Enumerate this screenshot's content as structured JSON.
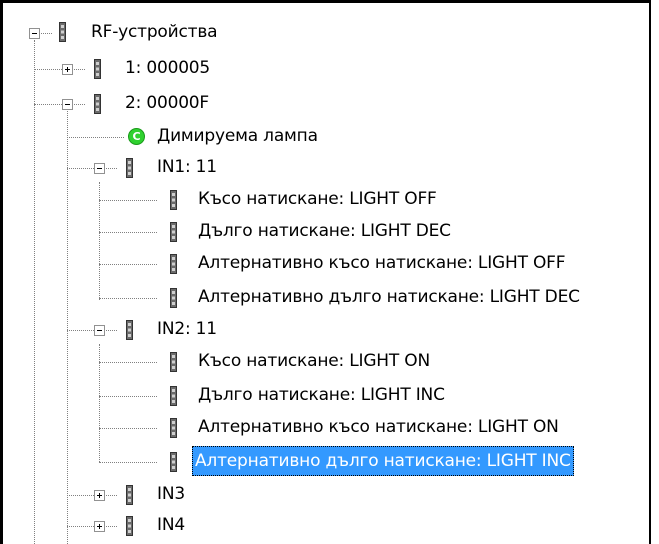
{
  "tree": {
    "root": {
      "label": "RF-устройства",
      "expanded": true
    },
    "dev1": {
      "label": "1: 000005",
      "expanded": false
    },
    "dev2": {
      "label": "2: 00000F",
      "expanded": true,
      "lamp": "Димируема лампа",
      "in1": {
        "label": "IN1: 11",
        "expanded": true,
        "items": [
          "Късо натискане: LIGHT OFF",
          "Дълго натискане: LIGHT DEC",
          "Алтернативно късо натискане: LIGHT OFF",
          "Алтернативно дълго натискане: LIGHT DEC"
        ]
      },
      "in2": {
        "label": "IN2: 11",
        "expanded": true,
        "items": [
          "Късо натискане: LIGHT ON",
          "Дълго натискане: LIGHT INC",
          "Алтернативно късо натискане: LIGHT ON",
          "Алтернативно дълго натискане: LIGHT INC"
        ],
        "selected_index": 3
      },
      "in3": {
        "label": "IN3",
        "expanded": false
      },
      "in4": {
        "label": "IN4",
        "expanded": false
      }
    }
  },
  "colors": {
    "selection": "#3399ff",
    "lamp_icon": "#2fd12f",
    "connector": "#808080"
  },
  "icons": {
    "device": "device-icon",
    "lamp": "dimmable-lamp-icon",
    "expand": "plus-icon",
    "collapse": "minus-icon"
  }
}
